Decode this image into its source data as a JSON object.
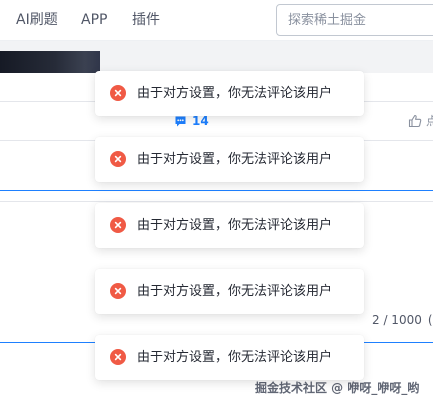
{
  "nav": {
    "items": [
      {
        "label": "AI刷题"
      },
      {
        "label": "APP"
      },
      {
        "label": "插件"
      }
    ],
    "search": {
      "placeholder": "探索稀土掘金"
    }
  },
  "article": {
    "comment_count": "14",
    "like_label": "点"
  },
  "editor": {
    "char_count": "2 / 1000",
    "char_count_suffix": "("
  },
  "toasts": [
    {
      "message": "由于对方设置，你无法评论该用户"
    },
    {
      "message": "由于对方设置，你无法评论该用户"
    },
    {
      "message": "由于对方设置，你无法评论该用户"
    },
    {
      "message": "由于对方设置，你无法评论该用户"
    },
    {
      "message": "由于对方设置，你无法评论该用户"
    }
  ],
  "watermark": "掘金技术社区 @ 咿呀_咿呀_哟",
  "colors": {
    "accent": "#1e80ff",
    "error": "#f05a45",
    "text": "#252933"
  },
  "icons": {
    "toast": "error-circle-icon",
    "comment": "comment-icon",
    "like": "thumbs-up-icon"
  }
}
